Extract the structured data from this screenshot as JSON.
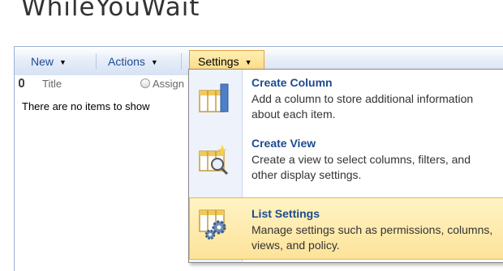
{
  "page": {
    "title": "WhileYouWait"
  },
  "toolbar": {
    "new_label": "New",
    "actions_label": "Actions",
    "settings_label": "Settings"
  },
  "list": {
    "columns": [
      "Title",
      "Assign"
    ],
    "empty_message": "There are no items to show"
  },
  "settings_menu": {
    "items": [
      {
        "title": "Create Column",
        "description": "Add a column to store additional information about each item.",
        "icon": "create-column-icon"
      },
      {
        "title": "Create View",
        "description": "Create a view to select columns, filters, and other display settings.",
        "icon": "create-view-icon"
      },
      {
        "title": "List Settings",
        "description": "Manage settings such as permissions, columns, views, and policy.",
        "icon": "list-settings-icon"
      }
    ]
  },
  "colors": {
    "link_blue": "#1d4b8f",
    "highlight": "#fde39a",
    "toolbar": "#d6e2f4"
  }
}
